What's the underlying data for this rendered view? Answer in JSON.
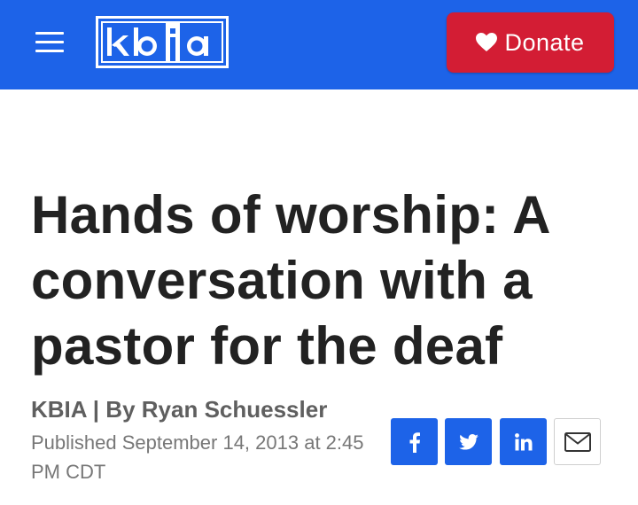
{
  "header": {
    "menu_icon": "hamburger-menu-icon",
    "logo_text": "kbia",
    "donate_label": "Donate",
    "donate_icon": "heart-icon",
    "bar_color": "#1d63e8",
    "donate_color": "#d31d34"
  },
  "article": {
    "headline": "Hands of worship: A conversation with a pastor for the deaf",
    "byline": "KBIA | By Ryan Schuessler",
    "published": "Published September 14, 2013 at 2:45 PM CDT"
  },
  "share": [
    {
      "network": "facebook",
      "icon": "facebook-icon"
    },
    {
      "network": "twitter",
      "icon": "twitter-icon"
    },
    {
      "network": "linkedin",
      "icon": "linkedin-icon"
    },
    {
      "network": "email",
      "icon": "email-icon"
    }
  ]
}
